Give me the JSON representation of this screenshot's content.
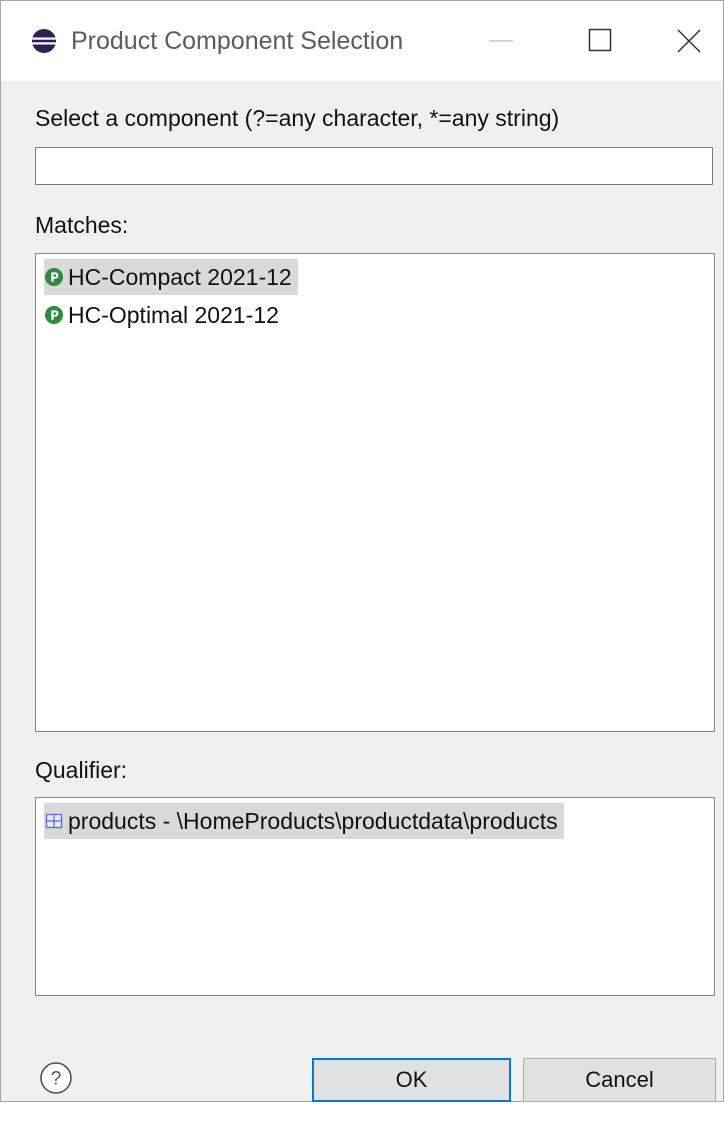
{
  "window": {
    "title": "Product Component Selection",
    "controls": {
      "minimize": "minimize-icon",
      "maximize": "maximize-icon",
      "close": "close-icon"
    }
  },
  "filter": {
    "label": "Select a component (?=any character, *=any string)",
    "value": "",
    "placeholder": ""
  },
  "matches": {
    "label": "Matches:",
    "items": [
      {
        "label": "HC-Compact 2021-12",
        "icon": "product-icon",
        "selected": true
      },
      {
        "label": "HC-Optimal 2021-12",
        "icon": "product-icon",
        "selected": false
      }
    ]
  },
  "qualifier": {
    "label": "Qualifier:",
    "items": [
      {
        "label": "products - \\HomeProducts\\productdata\\products",
        "icon": "package-icon",
        "selected": true
      }
    ]
  },
  "buttons": {
    "help_icon": "help-icon",
    "ok": "OK",
    "cancel": "Cancel"
  },
  "colors": {
    "accent": "#0078d7",
    "product_icon": "#2e8b3d",
    "selection": "#d9d9d9",
    "package_icon": "#5a6fd0"
  }
}
